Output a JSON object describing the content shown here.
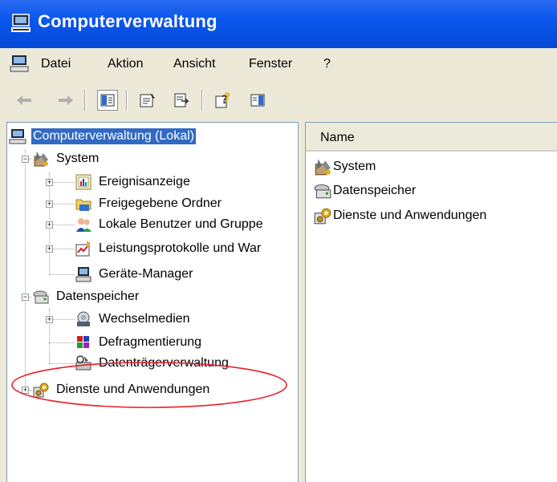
{
  "window": {
    "title": "Computerverwaltung"
  },
  "menu": [
    "Datei",
    "Aktion",
    "Ansicht",
    "Fenster",
    "?"
  ],
  "toolbar": {
    "buttons": [
      "back-arrow-icon",
      "forward-arrow-icon",
      "show-hide-tree-icon",
      "properties-icon",
      "export-list-icon",
      "help-icon",
      "action-pane-icon"
    ]
  },
  "tree": {
    "root": "Computerverwaltung (Lokal)",
    "system": "System",
    "ereignisanzeige": "Ereignisanzeige",
    "freigegebene_ordner": "Freigegebene Ordner",
    "lokale_benutzer": "Lokale Benutzer und Gruppe",
    "leistungsprotokolle": "Leistungsprotokolle und War",
    "geraete_manager": "Geräte-Manager",
    "datenspeicher": "Datenspeicher",
    "wechselmedien": "Wechselmedien",
    "defragmentierung": "Defragmentierung",
    "datentraeger": "Datenträgerverwaltung",
    "dienste": "Dienste und Anwendungen"
  },
  "list": {
    "header_name": "Name",
    "items": [
      "System",
      "Datenspeicher",
      "Dienste und Anwendungen"
    ]
  },
  "annotation": {
    "color": "#e8202a"
  },
  "colors": {
    "titlebar": "#0a57ee",
    "selection": "#316ac5",
    "chrome": "#ece9d8"
  }
}
